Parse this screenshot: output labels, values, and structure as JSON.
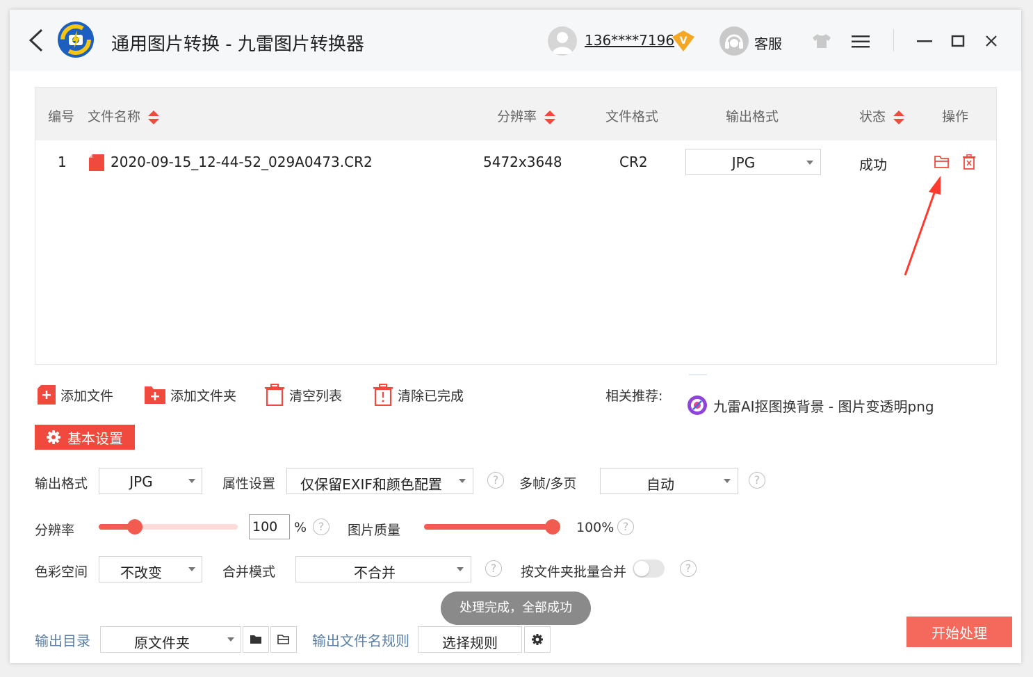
{
  "header": {
    "title": "通用图片转换 - 九雷图片转换器",
    "user_name": "136****7196",
    "vip_badge": "V",
    "service_label": "客服"
  },
  "table": {
    "columns": [
      "编号",
      "文件名称",
      "分辨率",
      "文件格式",
      "输出格式",
      "状态",
      "操作"
    ],
    "rows": [
      {
        "index": "1",
        "filename": "2020-09-15_12-44-52_029A0473.CR2",
        "resolution": "5472x3648",
        "format": "CR2",
        "output_format": "JPG",
        "status": "成功"
      }
    ]
  },
  "toolbar": {
    "add_file": "添加文件",
    "add_folder": "添加文件夹",
    "clear_list": "清空列表",
    "clear_done": "清除已完成",
    "recommend_label": "相关推荐:",
    "recommend_link": "九雷AI抠图换背景 - 图片变透明png"
  },
  "settings": {
    "basic_button": "基本设置",
    "output_format_label": "输出格式",
    "output_format_value": "JPG",
    "attribute_label": "属性设置",
    "attribute_value": "仅保留EXIF和颜色配置",
    "multiframe_label": "多帧/多页",
    "multiframe_value": "自动",
    "resolution_label": "分辨率",
    "resolution_value": "100",
    "resolution_unit": "%",
    "resolution_fraction": 0.23,
    "quality_label": "图片质量",
    "quality_value": "100%",
    "quality_fraction": 1.0,
    "color_space_label": "色彩空间",
    "color_space_value": "不改变",
    "merge_mode_label": "合并模式",
    "merge_mode_value": "不合并",
    "batch_merge_label": "按文件夹批量合并",
    "batch_merge_on": false
  },
  "footer": {
    "output_dir_label": "输出目录",
    "output_dir_value": "原文件夹",
    "filename_rule_label": "输出文件名规则",
    "rule_button": "选择规则",
    "start_button": "开始处理"
  },
  "toast": {
    "message": "处理完成，全部成功"
  },
  "colors": {
    "accent": "#ef4a3d",
    "start_button": "#f4695c",
    "link_blue": "#5b7fa6",
    "annotation_arrow": "#ff3b30"
  },
  "icons": {
    "back": "chevron-left-icon",
    "open_folder": "open-folder-icon",
    "delete": "trash-icon",
    "settings": "gear-icon",
    "help": "question-icon"
  }
}
